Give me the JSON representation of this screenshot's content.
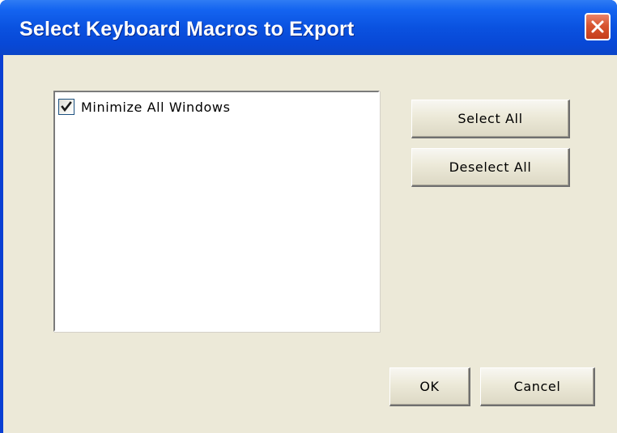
{
  "window": {
    "title": "Select Keyboard Macros to Export",
    "close_icon": "close-icon"
  },
  "macro_list": {
    "items": [
      {
        "label": "Minimize All Windows",
        "checked": true
      }
    ]
  },
  "buttons": {
    "select_all": "Select All",
    "deselect_all": "Deselect All",
    "ok": "OK",
    "cancel": "Cancel"
  },
  "colors": {
    "titlebar": "#0a52e0",
    "client_bg": "#ece9d8",
    "close_button": "#d8542f"
  }
}
